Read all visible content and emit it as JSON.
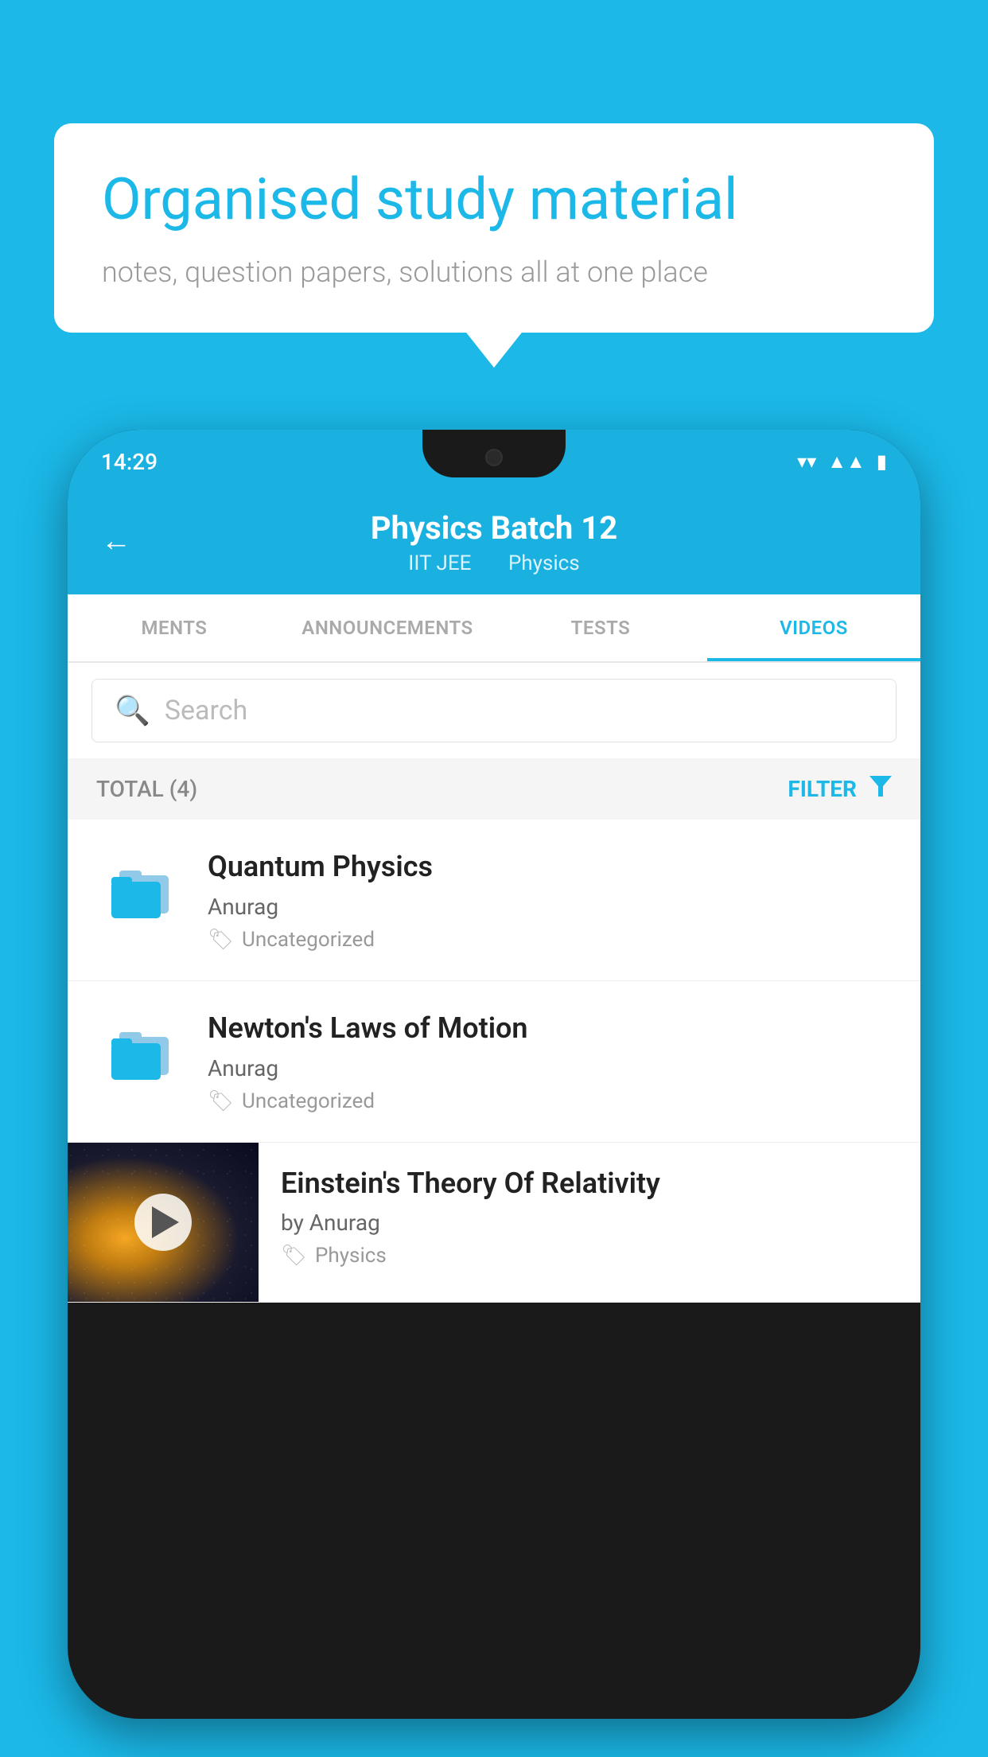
{
  "background_color": "#1bb8e8",
  "speech_bubble": {
    "heading": "Organised study material",
    "subtext": "notes, question papers, solutions all at one place"
  },
  "phone": {
    "status_bar": {
      "time": "14:29",
      "wifi_icon": "▾",
      "signal_icon": "▲",
      "battery_icon": "▮"
    },
    "header": {
      "back_label": "←",
      "title": "Physics Batch 12",
      "subtitle_part1": "IIT JEE",
      "subtitle_part2": "Physics"
    },
    "tabs": [
      {
        "label": "MENTS",
        "active": false
      },
      {
        "label": "ANNOUNCEMENTS",
        "active": false
      },
      {
        "label": "TESTS",
        "active": false
      },
      {
        "label": "VIDEOS",
        "active": true
      }
    ],
    "search": {
      "placeholder": "Search"
    },
    "filter_bar": {
      "total_label": "TOTAL (4)",
      "filter_label": "FILTER"
    },
    "videos": [
      {
        "id": 1,
        "type": "folder",
        "title": "Quantum Physics",
        "author": "Anurag",
        "tag": "Uncategorized"
      },
      {
        "id": 2,
        "type": "folder",
        "title": "Newton's Laws of Motion",
        "author": "Anurag",
        "tag": "Uncategorized"
      },
      {
        "id": 3,
        "type": "video",
        "title": "Einstein's Theory Of Relativity",
        "author": "by Anurag",
        "tag": "Physics"
      }
    ]
  }
}
